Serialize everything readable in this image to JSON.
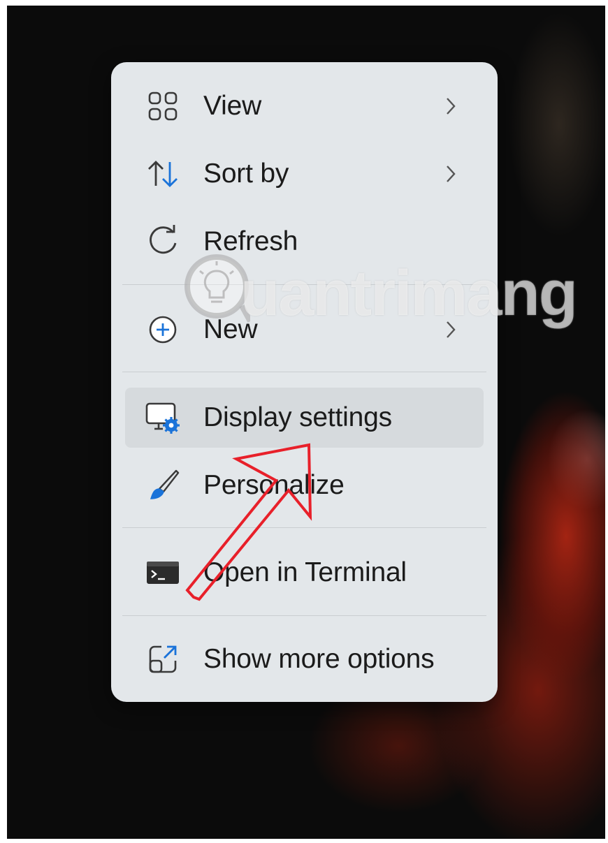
{
  "context_menu": {
    "items": [
      {
        "label": "View",
        "icon": "grid-icon",
        "has_submenu": true
      },
      {
        "label": "Sort by",
        "icon": "sort-arrows-icon",
        "has_submenu": true
      },
      {
        "label": "Refresh",
        "icon": "refresh-icon",
        "has_submenu": false
      },
      {
        "label": "New",
        "icon": "plus-circle-icon",
        "has_submenu": true
      },
      {
        "label": "Display settings",
        "icon": "display-settings-icon",
        "has_submenu": false,
        "highlighted": true
      },
      {
        "label": "Personalize",
        "icon": "brush-icon",
        "has_submenu": false
      },
      {
        "label": "Open in Terminal",
        "icon": "terminal-icon",
        "has_submenu": false
      },
      {
        "label": "Show more options",
        "icon": "expand-icon",
        "has_submenu": false
      }
    ]
  },
  "watermark": {
    "text": "uantrimang",
    "logo": "lightbulb-icon"
  },
  "annotation": {
    "type": "red-arrow",
    "points_to": "Display settings"
  },
  "colors": {
    "accent_blue": "#1a73d9",
    "menu_bg": "#e3e7ea",
    "arrow_red": "#e8202a",
    "hover_bg": "#d6dadd"
  }
}
